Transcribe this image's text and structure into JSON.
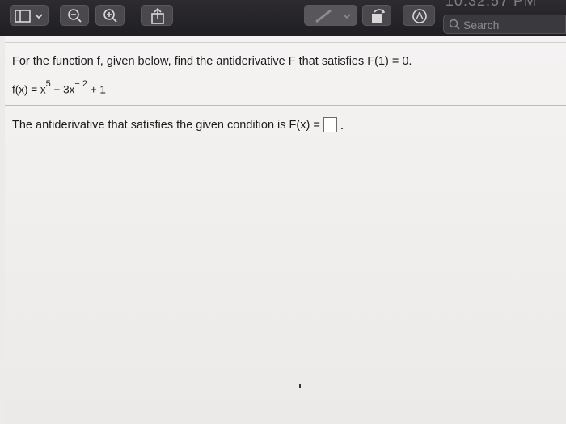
{
  "toolbar": {
    "clock_text": "10:32:57 PM",
    "search_placeholder": "Search",
    "icons": [
      "sidebar-icon",
      "zoom-out-icon",
      "zoom-in-icon",
      "share-icon",
      "markup-icon",
      "rotate-icon",
      "annotate-icon",
      "search-icon"
    ]
  },
  "problem": {
    "prompt": "For the function f, given below, find the antiderivative F that satisfies F(1) = 0.",
    "formula_lhs": "f(x) = x",
    "exp1": "5",
    "formula_mid": " − 3x",
    "exp2": "− 2",
    "formula_tail": " + 1",
    "answer_label": "The antiderivative that satisfies the given condition is F(x) =",
    "answer_value": ""
  }
}
